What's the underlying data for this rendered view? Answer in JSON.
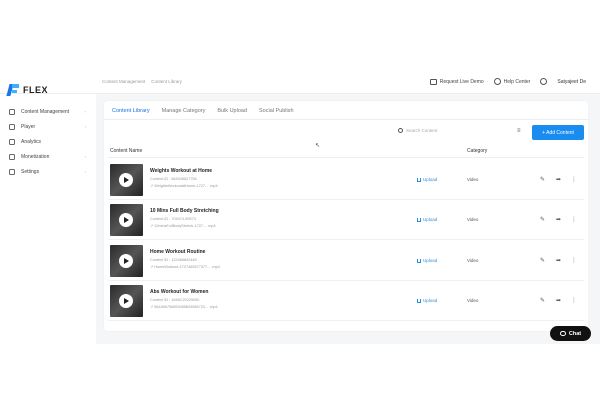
{
  "brand": {
    "name": "FLEX"
  },
  "breadcrumb": [
    "Content Management",
    "Content Library"
  ],
  "topbar": {
    "request_live_demo": "Request Live Demo",
    "help_center": "Help Center",
    "user_name": "Satyajeet De"
  },
  "sidebar": {
    "items": [
      {
        "label": "Content Management",
        "icon": "folder-icon"
      },
      {
        "label": "Player",
        "icon": "play-icon"
      },
      {
        "label": "Analytics",
        "icon": "chart-icon"
      },
      {
        "label": "Monetization",
        "icon": "calendar-icon"
      },
      {
        "label": "Settings",
        "icon": "gear-icon"
      }
    ]
  },
  "tabs": [
    {
      "label": "Content Library",
      "active": true
    },
    {
      "label": "Manage Category",
      "active": false
    },
    {
      "label": "Bulk Upload",
      "active": false
    },
    {
      "label": "Social Publish",
      "active": false
    }
  ],
  "search": {
    "placeholder": "Search Content"
  },
  "add_button": {
    "label": "+ Add Content"
  },
  "table": {
    "headers": {
      "name": "Content Name",
      "category": "Category"
    },
    "rows": [
      {
        "title": "Weights Workout at Home",
        "id": "Content ID : 664546627756",
        "file": "↗ WeightsWorkoutatHome-1727... .mp4",
        "status": "Upload",
        "category": "Video"
      },
      {
        "title": "10 Mins Full Body Stretching",
        "id": "Content ID : 704474-59573",
        "file": "↗ 10minsFullBodyStretch-1727... .mp4",
        "status": "Upload",
        "category": "Video"
      },
      {
        "title": "Home Workout Routine",
        "id": "Content ID : 122466842448",
        "file": "↗ HomeWorkout-1727465577377... .mp4",
        "status": "Upload",
        "category": "Video"
      },
      {
        "title": "Abs Workout for Women",
        "id": "Content ID : 1648C20225050",
        "file": "↗ 564456756853455843586723... .mp4",
        "status": "Upload",
        "category": "Video"
      }
    ]
  },
  "chat": {
    "label": "Chat"
  },
  "colors": {
    "accent": "#1a8cf0",
    "link": "#2f8fd8"
  }
}
